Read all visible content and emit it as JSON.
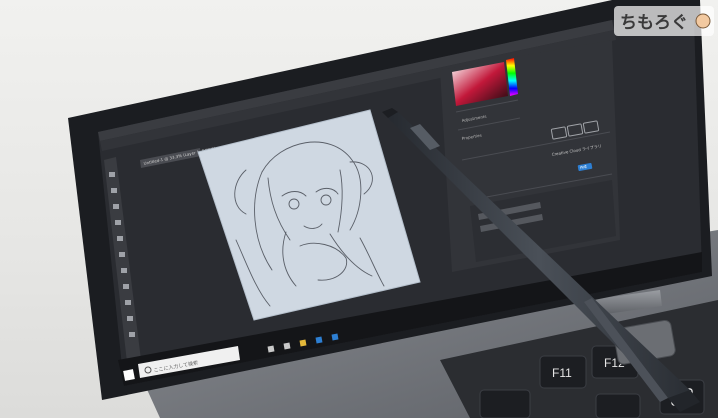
{
  "watermark": {
    "logo_text": "ちもろぐ",
    "tagline": "　"
  },
  "taskbar": {
    "search_placeholder": "ここに入力して検索"
  },
  "photoshop": {
    "doc_tab": "Untitled-1 @ 33.3% (Layer 1, RGB/8)",
    "panel_label_1": "Adjustments",
    "panel_label_2": "Properties",
    "cloud_label": "Creative Cloud ライブラリ",
    "cloud_button": "作成"
  },
  "keys": {
    "f11": "F11",
    "f12": "F12",
    "x": "X"
  },
  "colors": {
    "bezel": "#1d1f23",
    "canvas": "#cfd8e2",
    "pen": "#3a3f47",
    "accent": "#2d7fd3"
  }
}
